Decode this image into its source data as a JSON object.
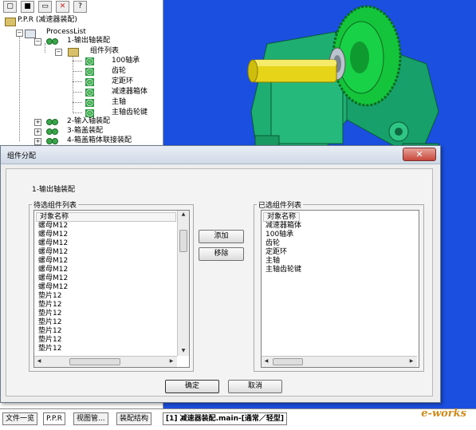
{
  "tree": {
    "root_label": "P.P.R (减速器装配)",
    "process_list_label": "ProcessList",
    "step1_label": "1-输出轴装配",
    "components_label": "组件列表",
    "parts": [
      "100轴承",
      "齿轮",
      "定距环",
      "减速器箱体",
      "主轴",
      "主轴齿轮键"
    ],
    "step2_label": "2-输入轴装配",
    "step3_label": "3-箱盖装配",
    "step4_label": "4-箱盖箱体联接装配"
  },
  "bottom_tabs": [
    "文件一览",
    "P.P.R",
    "视图管...",
    "装配结构"
  ],
  "document_tab": "[1] 减速器装配.main-[通常／轻型]",
  "watermark": "e-works",
  "dialog": {
    "title": "组件分配",
    "close_glyph": "✕",
    "step_label": "1-输出轴装配",
    "pending_group_label": "待选组件列表",
    "selected_group_label": "已选组件列表",
    "column_header": "对象名称",
    "pending_items": [
      "螺母M12",
      "螺母M12",
      "螺母M12",
      "螺母M12",
      "螺母M12",
      "螺母M12",
      "螺母M12",
      "螺母M12",
      "垫片12",
      "垫片12",
      "垫片12",
      "垫片12",
      "垫片12",
      "垫片12",
      "垫片12"
    ],
    "selected_items": [
      "减速器箱体",
      "100轴承",
      "齿轮",
      "定距环",
      "主轴",
      "主轴齿轮键"
    ],
    "add_button": "添加",
    "remove_button": "移除",
    "ok_button": "确定",
    "cancel_button": "取消"
  },
  "colors": {
    "viewport_background": "#1a4fe0",
    "housing": "#1fae72",
    "gear": "#14c43a",
    "shaft": "#e6d419",
    "accent_close": "#c6473a"
  },
  "icons": [
    "new-file-icon",
    "save-icon",
    "delete-icon",
    "help-icon",
    "assembly-icon",
    "part-icon",
    "folder-icon"
  ]
}
